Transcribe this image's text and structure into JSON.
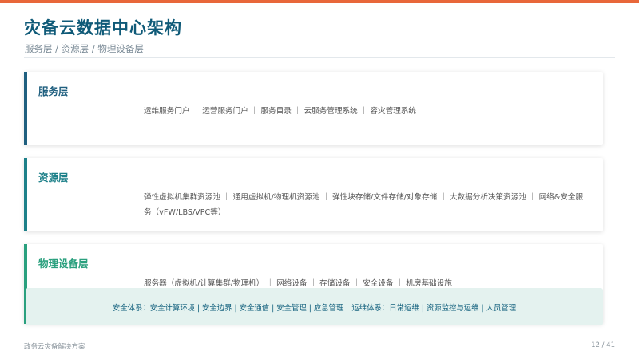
{
  "slide": {
    "title": "灾备云数据中心架构",
    "subtitle": "服务层 / 资源层 / 物理设备层"
  },
  "layers": {
    "service": {
      "title": "服务层",
      "body": "运维服务门户 ｜ 运营服务门户 ｜ 服务目录 ｜ 云服务管理系统 ｜ 容灾管理系统"
    },
    "resource": {
      "title": "资源层",
      "body": "弹性虚拟机集群资源池 ｜ 通用虚拟机/物理机资源池 ｜ 弹性块存储/文件存储/对象存储 ｜ 大数据分析决策资源池 ｜ 网络&安全服务（vFW/LBS/VPC等）"
    },
    "physical": {
      "title": "物理设备层",
      "body": "服务器（虚拟机/计算集群/物理机） ｜ 网络设备 ｜ 存储设备 ｜ 安全设备 ｜ 机房基础设施"
    }
  },
  "banner": {
    "security": "安全体系：安全计算环境 | 安全边界 | 安全通信 | 安全管理 | 应急管理",
    "ops": "运维体系：日常运维 | 资源监控与运维 | 人员管理"
  },
  "footer": {
    "doc_name": "政务云灾备解决方案",
    "page": "12 / 41"
  },
  "colors": {
    "accent_orange": "#e8673a",
    "title_blue": "#0f5a78",
    "service": "#1f5f7f",
    "resource": "#1d8089",
    "physical": "#2aa07e",
    "banner_bg": "#e4f2ef"
  }
}
